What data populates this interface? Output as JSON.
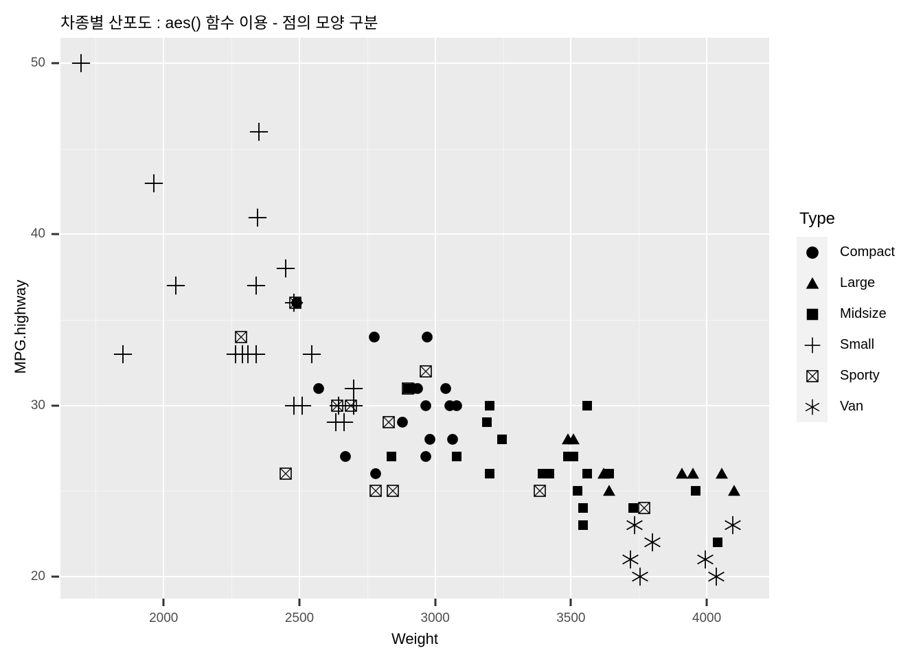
{
  "title": "차종별 산포도 : aes() 함수 이용 - 점의 모양 구분",
  "axes": {
    "x_title": "Weight",
    "y_title": "MPG.highway",
    "x_ticks": [
      2000,
      2500,
      3000,
      3500,
      4000
    ],
    "y_ticks": [
      20,
      30,
      40,
      50
    ],
    "x_minor": [
      1750,
      2250,
      2750,
      3250,
      3750,
      4250
    ],
    "y_minor": [
      25,
      35,
      45
    ]
  },
  "legend": {
    "title": "Type",
    "items": [
      {
        "label": "Compact",
        "shape": "circle-filled-icon"
      },
      {
        "label": "Large",
        "shape": "triangle-filled-icon"
      },
      {
        "label": "Midsize",
        "shape": "square-filled-icon"
      },
      {
        "label": "Small",
        "shape": "plus-icon"
      },
      {
        "label": "Sporty",
        "shape": "square-cross-icon"
      },
      {
        "label": "Van",
        "shape": "asterisk-icon"
      }
    ]
  },
  "theme": {
    "panel_background": "#EBEBEB",
    "grid_major": "#FFFFFF",
    "grid_minor": "#F5F5F5",
    "marker_color": "#000000",
    "axis_text": "#4D4D4D",
    "legend_key_background": "#F2F2F2",
    "plot_background": "#FFFFFF"
  },
  "chart_data": {
    "type": "scatter",
    "title": "차종별 산포도 : aes() 함수 이용 - 점의 모양 구분",
    "xlabel": "Weight",
    "ylabel": "MPG.highway",
    "xlim": [
      1620,
      4230
    ],
    "ylim": [
      18.7,
      51.5
    ],
    "grid": true,
    "legend_position": "right",
    "legend_title": "Type",
    "shape_mapping": {
      "Compact": "circle-filled",
      "Large": "triangle-filled",
      "Midsize": "square-filled",
      "Small": "plus",
      "Sporty": "square-cross",
      "Van": "asterisk"
    },
    "series": [
      {
        "name": "Compact",
        "points": [
          [
            2490,
            36
          ],
          [
            2570,
            31
          ],
          [
            2775,
            34
          ],
          [
            2970,
            34
          ],
          [
            2880,
            29
          ],
          [
            2920,
            31
          ],
          [
            2935,
            31
          ],
          [
            2965,
            30
          ],
          [
            3040,
            31
          ],
          [
            3055,
            30
          ],
          [
            3080,
            30
          ],
          [
            2980,
            28
          ],
          [
            3065,
            28
          ],
          [
            2965,
            27
          ],
          [
            2670,
            27
          ],
          [
            2780,
            26
          ]
        ]
      },
      {
        "name": "Large",
        "points": [
          [
            3490,
            28
          ],
          [
            3510,
            28
          ],
          [
            3620,
            26
          ],
          [
            3640,
            25
          ],
          [
            3910,
            26
          ],
          [
            3950,
            26
          ],
          [
            4055,
            26
          ],
          [
            4100,
            25
          ]
        ]
      },
      {
        "name": "Midsize",
        "points": [
          [
            2900,
            31
          ],
          [
            3200,
            30
          ],
          [
            3560,
            30
          ],
          [
            3190,
            29
          ],
          [
            3245,
            28
          ],
          [
            2840,
            27
          ],
          [
            3080,
            27
          ],
          [
            3490,
            27
          ],
          [
            3510,
            27
          ],
          [
            3200,
            26
          ],
          [
            3395,
            26
          ],
          [
            3420,
            26
          ],
          [
            3560,
            26
          ],
          [
            3640,
            26
          ],
          [
            3525,
            25
          ],
          [
            3960,
            25
          ],
          [
            3545,
            24
          ],
          [
            3730,
            24
          ],
          [
            3545,
            23
          ],
          [
            4040,
            22
          ]
        ]
      },
      {
        "name": "Small",
        "points": [
          [
            1695,
            50
          ],
          [
            2350,
            46
          ],
          [
            1965,
            43
          ],
          [
            2345,
            41
          ],
          [
            2450,
            38
          ],
          [
            2045,
            37
          ],
          [
            2340,
            37
          ],
          [
            2480,
            36
          ],
          [
            1850,
            33
          ],
          [
            2265,
            33
          ],
          [
            2290,
            33
          ],
          [
            2310,
            33
          ],
          [
            2340,
            33
          ],
          [
            2545,
            33
          ],
          [
            2700,
            31
          ],
          [
            2480,
            30
          ],
          [
            2510,
            30
          ],
          [
            2645,
            30
          ],
          [
            2700,
            30
          ],
          [
            2635,
            29
          ],
          [
            2665,
            29
          ]
        ]
      },
      {
        "name": "Sporty",
        "points": [
          [
            2485,
            36
          ],
          [
            2285,
            34
          ],
          [
            2965,
            32
          ],
          [
            2900,
            31
          ],
          [
            2640,
            30
          ],
          [
            2690,
            30
          ],
          [
            2830,
            29
          ],
          [
            2450,
            26
          ],
          [
            2780,
            25
          ],
          [
            2845,
            25
          ],
          [
            3385,
            25
          ],
          [
            3770,
            24
          ]
        ]
      },
      {
        "name": "Van",
        "points": [
          [
            3735,
            23
          ],
          [
            4095,
            23
          ],
          [
            3800,
            22
          ],
          [
            3720,
            21
          ],
          [
            3995,
            21
          ],
          [
            3755,
            20
          ],
          [
            4035,
            20
          ]
        ]
      }
    ]
  }
}
